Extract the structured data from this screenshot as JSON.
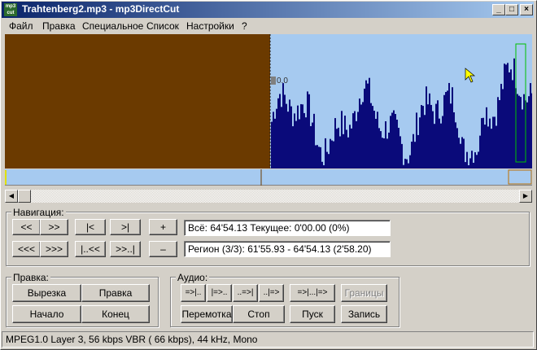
{
  "window": {
    "title": "Trahtenberg2.mp3 - mp3DirectCut",
    "app_icon": "mp3-icon",
    "controls": [
      "_",
      "□",
      "×"
    ]
  },
  "menu": [
    "Файл",
    "Правка",
    "Специальное",
    "Список",
    "Настройки",
    "?"
  ],
  "waveform": {
    "level_label": "0.0",
    "colors": {
      "played": "#6b3a00",
      "background": "#a6caf0",
      "wave": "#0a0a7a",
      "marker": "#00c000"
    }
  },
  "navigation": {
    "label": "Навигация:",
    "row1": [
      "<<",
      ">>",
      "|<",
      ">|",
      "+"
    ],
    "row2": [
      "<<<",
      ">>>",
      "|..<<",
      ">>..|",
      "–"
    ],
    "total": "Всё: 64'54.13   Текущее: 0'00.00   (0%)",
    "region": "Регион (3/3): 61'55.93 - 64'54.13 (2'58.20)"
  },
  "edit": {
    "label": "Правка:",
    "cut": "Вырезка",
    "edit": "Правка",
    "start": "Начало",
    "end": "Конец"
  },
  "audio": {
    "label": "Аудио:",
    "row1": [
      "=>|..",
      "|=>..",
      "..=>|",
      "..|=>",
      "=>|...|=>",
      "Границы"
    ],
    "row2": [
      "Перемотка",
      "Стоп",
      "Пуск",
      "Запись"
    ]
  },
  "status": "MPEG1.0 Layer 3, 56 kbps VBR ( 66 kbps), 44 kHz, Mono"
}
